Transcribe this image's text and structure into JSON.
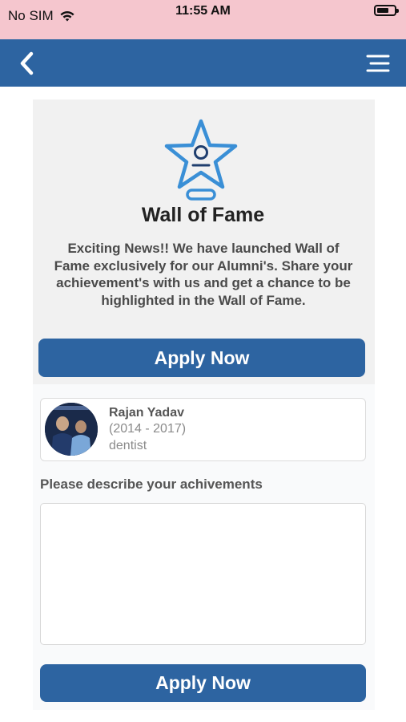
{
  "status_bar": {
    "carrier": "No SIM",
    "time": "11:55 AM",
    "battery_level": 0.7
  },
  "nav": {
    "back_icon": "chevron-left-icon",
    "menu_icon": "hamburger-menu-icon"
  },
  "wall_of_fame": {
    "icon": "star-trophy-icon",
    "title": "Wall of Fame",
    "description": "Exciting News!! We have launched Wall of Fame exclusively for our Alumni's. Share your achievement's with us and get a chance to be highlighted in the Wall of Fame.",
    "apply_label": "Apply Now"
  },
  "profile": {
    "name": "Rajan Yadav",
    "years": " (2014 - 2017)",
    "role": "dentist"
  },
  "achievements": {
    "label": "Please describe your achivements",
    "value": "",
    "submit_label": "Apply Now"
  },
  "colors": {
    "status_bar_bg": "#f5c6ce",
    "primary": "#2d64a1",
    "star_stroke": "#3a8fd6"
  }
}
